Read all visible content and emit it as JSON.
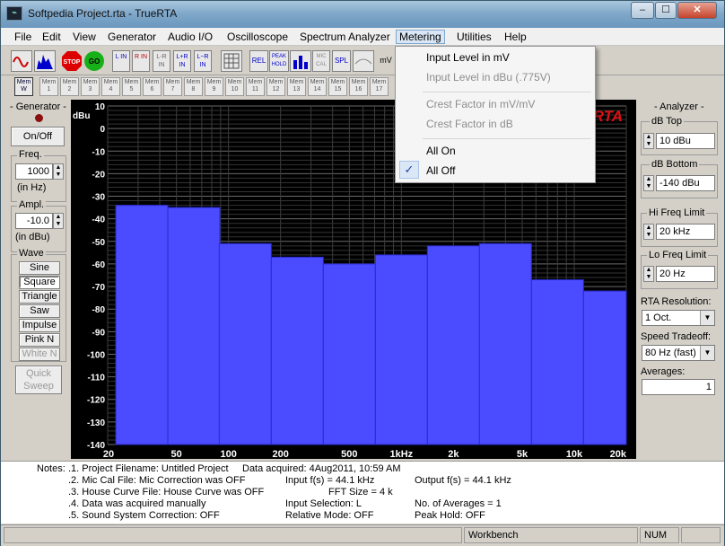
{
  "window": {
    "title": "Softpedia Project.rta - TrueRTA",
    "minimize": "–",
    "maximize": "☐",
    "close": "✕",
    "app_icon": "⌁"
  },
  "menus": [
    "File",
    "Edit",
    "View",
    "Generator",
    "Audio I/O",
    "Oscilloscope",
    "Spectrum Analyzer",
    "Metering",
    "Utilities",
    "Help"
  ],
  "toolbar": {
    "stop": "STOP",
    "go": "GO",
    "channels": [
      "L IN",
      "R IN",
      "L-R IN",
      "L+R IN",
      "L−R IN"
    ],
    "rel": "REL",
    "peak_hold": "PEAK HOLD",
    "mic_cal": "MIC CAL",
    "spl": "SPL",
    "mv": "mV"
  },
  "mem_buttons": [
    "Mem W",
    "Mem 1",
    "Mem 2",
    "Mem 3",
    "Mem 4",
    "Mem 5",
    "Mem 6",
    "Mem 7",
    "Mem 8",
    "Mem 9",
    "Mem 10",
    "Mem 11",
    "Mem 12",
    "Mem 13",
    "Mem 14",
    "Mem 15",
    "Mem 16",
    "Mem 17"
  ],
  "generator": {
    "title": "- Generator -",
    "onoff": "On/Off",
    "freq_label": "Freq.",
    "freq_value": "1000",
    "freq_unit": "(in Hz)",
    "ampl_label": "Ampl.",
    "ampl_value": "-10.0",
    "ampl_unit": "(in dBu)",
    "wave_label": "Wave",
    "waves": [
      "Sine",
      "Square",
      "Triangle",
      "Saw",
      "Impulse",
      "Pink N",
      "White N"
    ],
    "quick_sweep": "Quick Sweep"
  },
  "analyzer": {
    "title": "- Analyzer -",
    "db_top_label": "dB Top",
    "db_top_value": "10 dBu",
    "db_bottom_label": "dB Bottom",
    "db_bottom_value": "-140 dBu",
    "hi_freq_label": "Hi Freq Limit",
    "hi_freq_value": "20 kHz",
    "lo_freq_label": "Lo Freq Limit",
    "lo_freq_value": "20 Hz",
    "rta_res_label": "RTA Resolution:",
    "rta_res_value": "1 Oct.",
    "speed_label": "Speed Tradeoff:",
    "speed_value": "80 Hz (fast)",
    "averages_label": "Averages:",
    "averages_value": "1"
  },
  "chart_data": {
    "type": "bar",
    "ylabel": "dBu",
    "ylim": [
      -140,
      10
    ],
    "yticks": [
      "10",
      "0",
      "-10",
      "-20",
      "-30",
      "-40",
      "-50",
      "-60",
      "-70",
      "-80",
      "-90",
      "-100",
      "-110",
      "-120",
      "-130",
      "-140"
    ],
    "xticks": [
      "20",
      "50",
      "100",
      "200",
      "500",
      "1kHz",
      "2k",
      "5k",
      "10k",
      "20k"
    ],
    "bands": [
      "31.5",
      "63",
      "125",
      "250",
      "500",
      "1k",
      "2k",
      "4k",
      "8k",
      "16k"
    ],
    "values": [
      -34,
      -35,
      -51,
      -57,
      -60,
      -56,
      -52,
      -51,
      -67,
      -72
    ],
    "bar_color": "#4b4bff",
    "brand_text": "RTA",
    "brand_color": "#e01010"
  },
  "notes": {
    "label": "Notes:",
    "lines": [
      ".1. Project Filename: Untitled Project",
      ".2. Mic Cal File: Mic Correction was OFF",
      ".3. House Curve File: House Curve was OFF",
      ".4. Data was acquired manually",
      ".5. Sound System Correction: OFF"
    ],
    "col2": [
      "Data acquired: 4Aug2011, 10:59 AM",
      "Input f(s) = 44.1 kHz",
      "FFT Size = 4 k",
      "Input Selection: L",
      "Relative Mode:  OFF"
    ],
    "col3": [
      "Output f(s) = 44.1 kHz",
      "No. of Averages = 1",
      "Peak Hold: OFF"
    ]
  },
  "status": {
    "workbench": "Workbench",
    "num": "NUM"
  },
  "metering_menu": {
    "items": [
      "Input Level in mV",
      "Input Level in dBu (.775V)",
      "Crest Factor in mV/mV",
      "Crest Factor in dB",
      "All On",
      "All Off"
    ],
    "check": "✓"
  }
}
